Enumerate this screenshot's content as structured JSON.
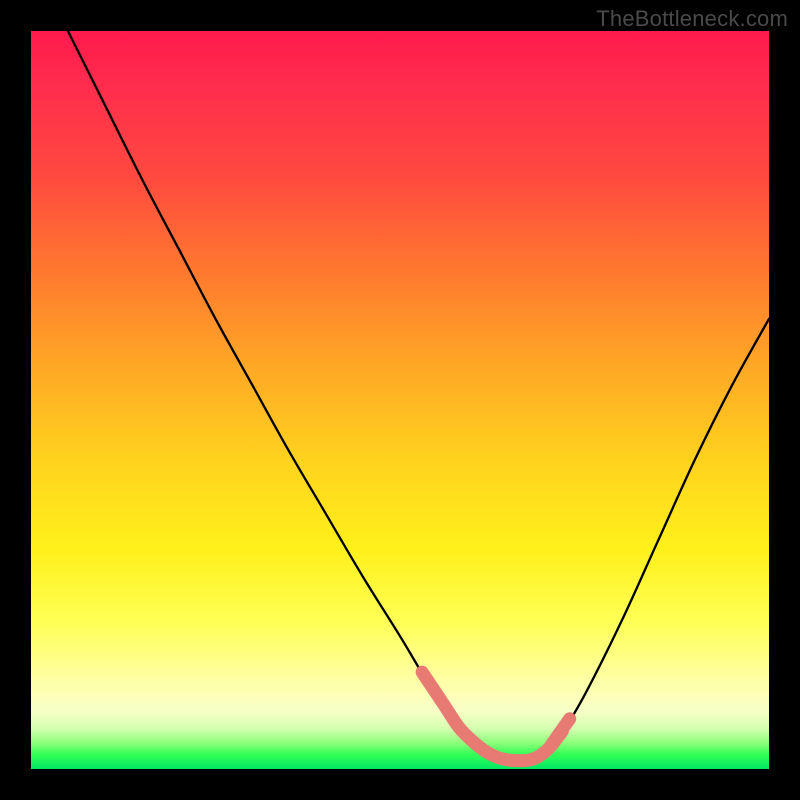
{
  "watermark": "TheBottleneck.com",
  "chart_data": {
    "type": "line",
    "title": "",
    "xlabel": "",
    "ylabel": "",
    "xlim": [
      0,
      100
    ],
    "ylim": [
      0,
      100
    ],
    "series": [
      {
        "name": "curve",
        "x": [
          5,
          10,
          15,
          20,
          25,
          30,
          35,
          40,
          45,
          50,
          53,
          56,
          58,
          60,
          62,
          64,
          66,
          68,
          70,
          72,
          75,
          80,
          85,
          90,
          95,
          100
        ],
        "y": [
          100,
          90,
          80,
          70.5,
          61,
          52,
          43,
          34.5,
          26,
          18,
          13,
          8.5,
          5.5,
          3.5,
          2,
          1.2,
          1,
          1.2,
          2.5,
          5,
          10,
          20,
          31,
          42,
          52,
          61
        ]
      }
    ],
    "flat_region": {
      "name": "highlight-band",
      "x": [
        53,
        72
      ],
      "comment": "salmon-colored rounded highlight along the curve near its minimum"
    },
    "colors": {
      "curve": "#000000",
      "highlight": "#e77b74",
      "gradient_top": "#ff1a4d",
      "gradient_mid": "#ffd21e",
      "gradient_bottom": "#00e865"
    }
  }
}
